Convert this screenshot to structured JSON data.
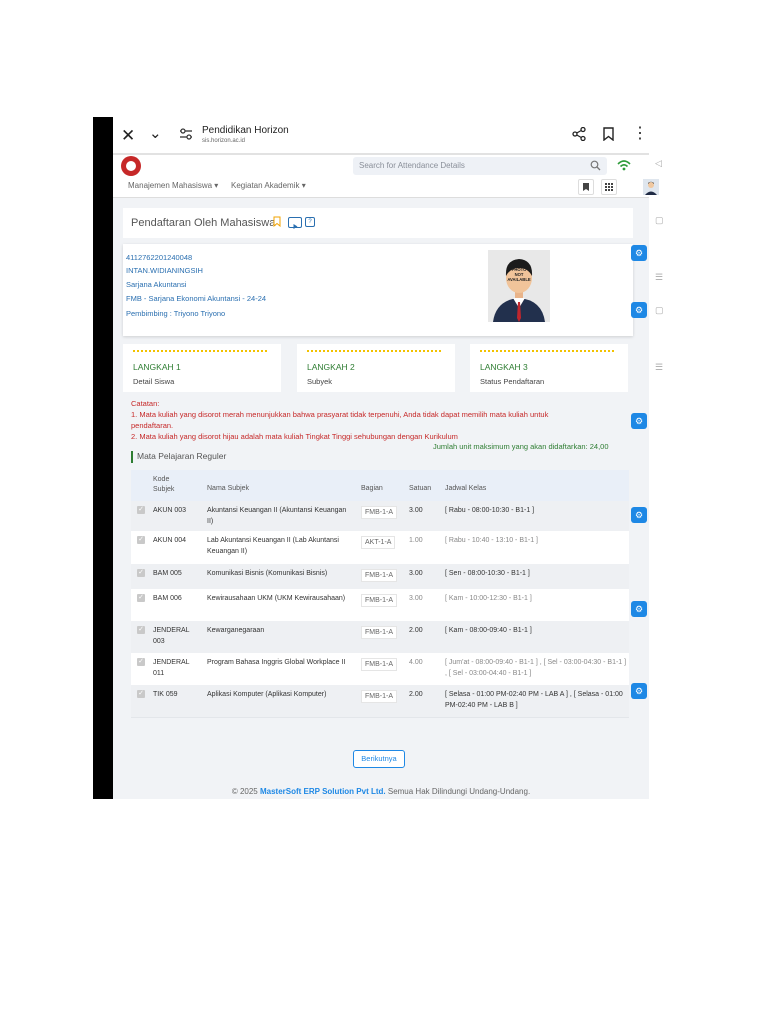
{
  "browser": {
    "title": "Pendidikan Horizon",
    "url": "sis.horizon.ac.id"
  },
  "header": {
    "search_placeholder": "Search for Attendance Details"
  },
  "menu": {
    "items": [
      "Manajemen Mahasiswa ▾",
      "Kegiatan Akademik ▾"
    ]
  },
  "page": {
    "title": "Pendaftaran Oleh Mahasiswa",
    "help": "?"
  },
  "profile": {
    "id": "4112762201240048",
    "name": "INTAN.WIDIANINGSIH",
    "program": "Sarjana Akuntansi",
    "faculty": "FMB - Sarjana Ekonomi Akuntansi - 24-24",
    "advisor": "Pembimbing : Triyono Triyono",
    "photo_text": [
      "PHOTO",
      "NOT",
      "AVAILABLE"
    ]
  },
  "steps": [
    {
      "label": "LANGKAH 1",
      "sub": "Detail Siswa"
    },
    {
      "label": "LANGKAH 2",
      "sub": "Subyek"
    },
    {
      "label": "LANGKAH 3",
      "sub": "Status Pendaftaran"
    }
  ],
  "notes": {
    "heading": "Catatan:",
    "line1": "1. Mata kuliah yang disorot merah menunjukkan bahwa prasyarat tidak terpenuhi, Anda tidak dapat memilih mata kuliah untuk",
    "line1b": "pendaftaran.",
    "line2": "2. Mata kuliah yang disorot hijau adalah mata kuliah Tingkat Tinggi sehubungan dengan Kurikulum",
    "max_units": "Jumlah unit maksimum yang akan didaftarkan: 24,00"
  },
  "section_title": "Mata Pelajaran Reguler",
  "table": {
    "headers": {
      "kode": "Kode\nSubjek",
      "nama": "Nama Subjek",
      "bagian": "Bagian",
      "satuan": "Satuan",
      "jadwal": "Jadwal Kelas"
    },
    "rows": [
      {
        "kode": "AKUN 003",
        "nama": "Akuntansi Keuangan II (Akuntansi Keuangan II)",
        "bagian": "FMB-1-A",
        "satuan": "3.00",
        "jadwal": "[ Rabu - 08:00-10:30 - B1-1 ]",
        "dim": false
      },
      {
        "kode": "AKUN 004",
        "nama": "Lab Akuntansi Keuangan II (Lab Akuntansi Keuangan II)",
        "bagian": "AKT-1-A",
        "satuan": "1.00",
        "jadwal": "[ Rabu - 10:40 - 13:10 - B1-1 ]",
        "dim": true
      },
      {
        "kode": "BAM 005",
        "nama": "Komunikasi Bisnis (Komunikasi Bisnis)",
        "bagian": "FMB-1-A",
        "satuan": "3.00",
        "jadwal": "[ Sen - 08:00-10:30 - B1-1 ]",
        "dim": false
      },
      {
        "kode": "BAM 006",
        "nama": "Kewirausahaan UKM (UKM Kewirausahaan)",
        "bagian": "FMB-1-A",
        "satuan": "3.00",
        "jadwal": "[ Kam - 10:00-12:30 - B1-1 ]",
        "dim": true
      },
      {
        "kode": "JENDERAL 003",
        "nama": "Kewarganegaraan",
        "bagian": "FMB-1-A",
        "satuan": "2.00",
        "jadwal": "[ Kam - 08:00-09:40 - B1-1 ]",
        "dim": false
      },
      {
        "kode": "JENDERAL 011",
        "nama": "Program Bahasa Inggris Global Workplace II",
        "bagian": "FMB-1-A",
        "satuan": "4.00",
        "jadwal": "[ Jum'at - 08:00-09:40 - B1-1 ] , [ Sel - 03:00-04:30 - B1-1 ] , [ Sel - 03:00-04:40 - B1-1 ]",
        "dim": true
      },
      {
        "kode": "TIK 059",
        "nama": "Aplikasi Komputer (Aplikasi Komputer)",
        "bagian": "FMB-1-A",
        "satuan": "2.00",
        "jadwal": "[ Selasa - 01:00 PM-02:40 PM - LAB A ] , [ Selasa - 01:00 PM-02:40 PM - LAB B ]",
        "dim": false
      }
    ]
  },
  "next_button": "Berikutnya",
  "footer": {
    "prefix": "© 2025",
    "company": "MasterSoft ERP Solution Pvt Ltd.",
    "suffix": "Semua Hak Dilindungi Undang-Undang."
  },
  "colors": {
    "link_blue": "#2a6fb0",
    "accent_blue": "#1e88e5",
    "green": "#2e7d32",
    "red": "#c62828",
    "step_dots": "#f2c200"
  }
}
